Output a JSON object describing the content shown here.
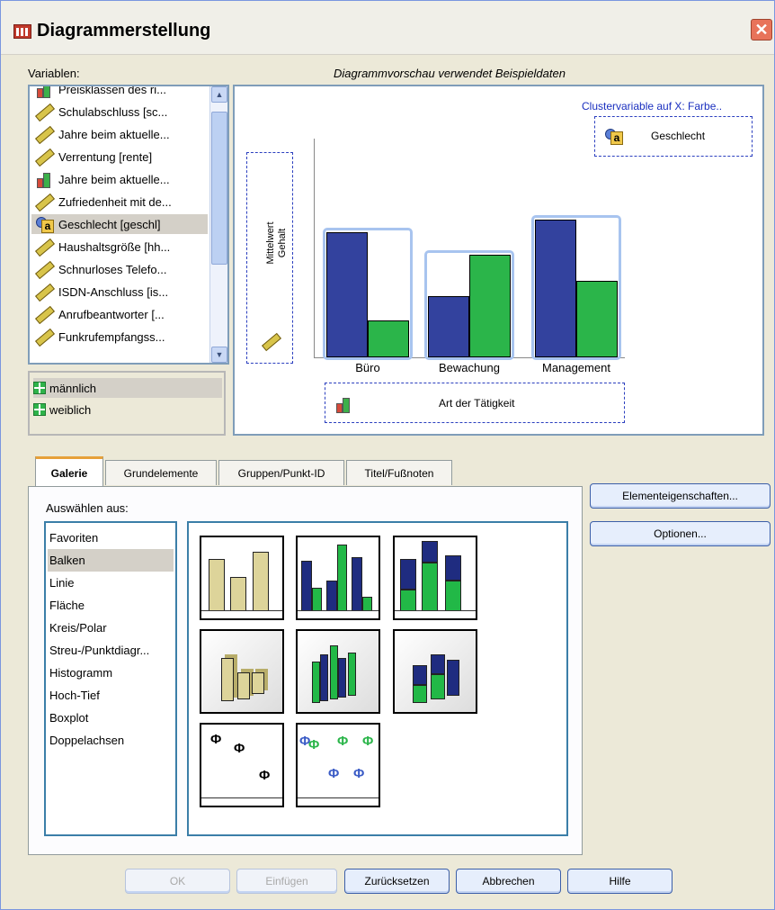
{
  "window": {
    "title": "Diagrammerstellung",
    "close_glyph": "✕"
  },
  "labels": {
    "variables": "Variablen:",
    "preview_caption": "Diagrammvorschau verwendet Beispieldaten",
    "select_from": "Auswählen aus:"
  },
  "variables": [
    {
      "label": "Preisklassen des ri...",
      "icon": "bar-chart-icon"
    },
    {
      "label": "Schulabschluss [sc...",
      "icon": "ruler-icon"
    },
    {
      "label": "Jahre beim aktuelle...",
      "icon": "ruler-icon"
    },
    {
      "label": "Verrentung [rente]",
      "icon": "ruler-icon"
    },
    {
      "label": "Jahre beim aktuelle...",
      "icon": "bar-chart-icon"
    },
    {
      "label": "Zufriedenheit mit de...",
      "icon": "ruler-icon"
    },
    {
      "label": "Geschlecht [geschl]",
      "icon": "nominal-icon",
      "selected": true
    },
    {
      "label": "Haushaltsgröße [hh...",
      "icon": "ruler-icon"
    },
    {
      "label": "Schnurloses Telefo...",
      "icon": "ruler-icon"
    },
    {
      "label": "ISDN-Anschluss [is...",
      "icon": "ruler-icon"
    },
    {
      "label": "Anrufbeantworter [...",
      "icon": "ruler-icon"
    },
    {
      "label": "Funkrufempfangss...",
      "icon": "ruler-icon"
    }
  ],
  "categories": [
    {
      "label": "männlich",
      "selected": true
    },
    {
      "label": "weiblich"
    }
  ],
  "preview": {
    "cluster_label": "Clustervariable auf X: Farbe..",
    "cluster_var": "Geschlecht",
    "y_label_line1": "Mittelwert",
    "y_label_line2": "Gehalt",
    "x_var": "Art der Tätigkeit"
  },
  "chart_data": {
    "type": "bar",
    "categories": [
      "Büro",
      "Bewachung",
      "Management"
    ],
    "series": [
      {
        "name": "männlich",
        "color": "#33429e",
        "values": [
          0.57,
          0.28,
          0.63
        ]
      },
      {
        "name": "weiblich",
        "color": "#2bb54a",
        "values": [
          0.17,
          0.47,
          0.35
        ]
      }
    ],
    "xlabel": "Art der Tätigkeit",
    "ylabel": "Mittelwert Gehalt"
  },
  "tabs": [
    "Galerie",
    "Grundelemente",
    "Gruppen/Punkt-ID",
    "Titel/Fußnoten"
  ],
  "chart_types": [
    "Favoriten",
    "Balken",
    "Linie",
    "Fläche",
    "Kreis/Polar",
    "Streu-/Punktdiagr...",
    "Histogramm",
    "Hoch-Tief",
    "Boxplot",
    "Doppelachsen"
  ],
  "selected_chart_type": "Balken",
  "side_buttons": {
    "element_properties": "Elementeigenschaften...",
    "options": "Optionen..."
  },
  "footer_buttons": {
    "ok": "OK",
    "paste": "Einfügen",
    "reset": "Zurücksetzen",
    "cancel": "Abbrechen",
    "help": "Hilfe"
  }
}
